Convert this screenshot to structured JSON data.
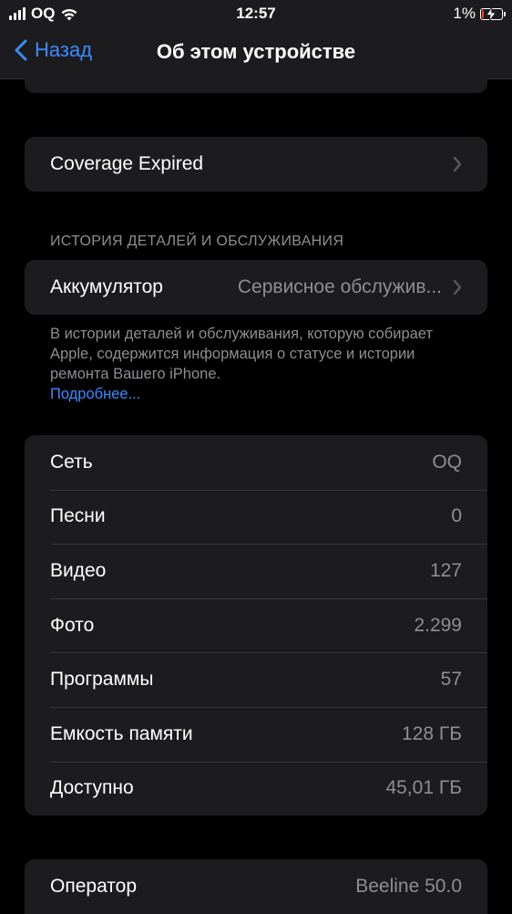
{
  "status_bar": {
    "carrier": "OQ",
    "time": "12:57",
    "battery_percent": "1%",
    "battery_level": 0.01,
    "icons": [
      "signal-icon",
      "wifi-icon",
      "battery-icon",
      "charging-bolt-icon"
    ]
  },
  "nav": {
    "back_label": "Назад",
    "title": "Об этом устройстве",
    "back_icon": "chevron-left-icon"
  },
  "coverage": {
    "label": "Coverage Expired",
    "icon": "chevron-right-icon"
  },
  "parts_history": {
    "header": "ИСТОРИЯ ДЕТАЛЕЙ И ОБСЛУЖИВАНИЯ",
    "battery_label": "Аккумулятор",
    "battery_value": "Сервисное обслужив...",
    "footer": "В истории деталей и обслуживания, которую собирает Apple, содержится информация о статусе и истории ремонта Вашего iPhone.",
    "more_link": "Подробнее..."
  },
  "device_info": {
    "rows": [
      {
        "label": "Сеть",
        "value": "OQ"
      },
      {
        "label": "Песни",
        "value": "0"
      },
      {
        "label": "Видео",
        "value": "127"
      },
      {
        "label": "Фото",
        "value": "2.299"
      },
      {
        "label": "Программы",
        "value": "57"
      },
      {
        "label": "Емкость памяти",
        "value": "128 ГБ"
      },
      {
        "label": "Доступно",
        "value": "45,01 ГБ"
      }
    ]
  },
  "carrier_section": {
    "label": "Оператор",
    "value": "Beeline 50.0"
  },
  "colors": {
    "background": "#000000",
    "cell_background": "#1c1c1e",
    "accent": "#3a8cff",
    "secondary_text": "#8e8e93",
    "battery_low": "#ff3b30"
  }
}
